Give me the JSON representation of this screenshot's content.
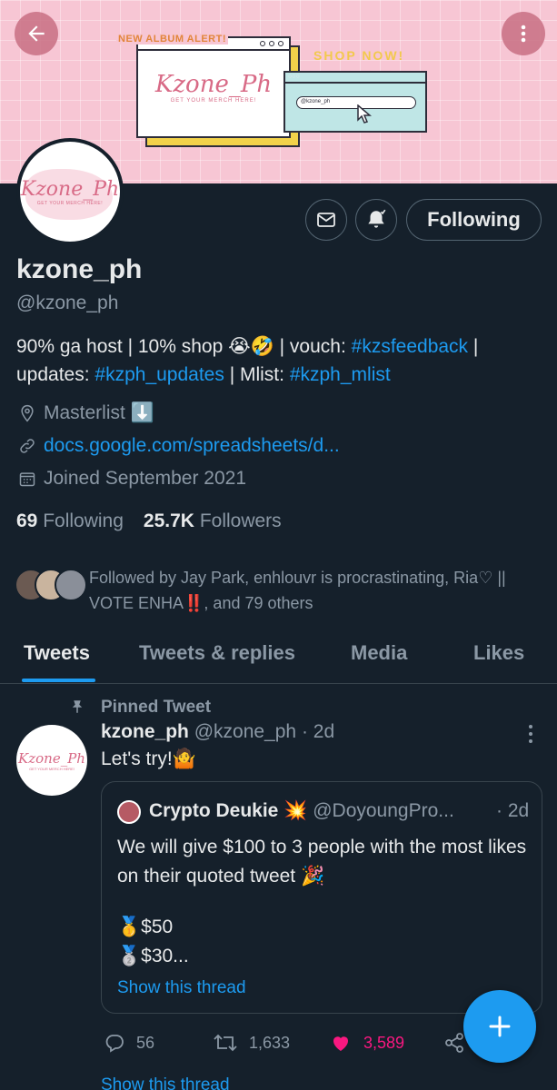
{
  "banner": {
    "alert_text": "NEW ALBUM ALERT!",
    "shop_text": "SHOP NOW!",
    "brand_script": "Kzone_Ph",
    "brand_tagline": "GET YOUR MERCH HERE!",
    "search_value": "@kzone_ph"
  },
  "avatar": {
    "brand_script": "Kzone_Ph",
    "tagline": "GET YOUR MERCH HERE!"
  },
  "profile": {
    "display_name": "kzone_ph",
    "handle": "@kzone_ph",
    "bio_1": "90% ga host | 10% shop 😭🤣 | vouch: ",
    "bio_hashtag_1": "#kzsfeedback",
    "bio_2": " |",
    "bio_3": "updates: ",
    "bio_hashtag_2": "#kzph_updates",
    "bio_4": " |  Mlist: ",
    "bio_hashtag_3": "#kzph_mlist",
    "location": "Masterlist ⬇️",
    "website": "docs.google.com/spreadsheets/d...",
    "joined": "Joined September 2021",
    "following_count": "69",
    "following_label": "Following",
    "followers_count": "25.7K",
    "followers_label": "Followers",
    "followed_by": "Followed by Jay Park, enhlouvr is procrastinating, Ria♡ || VOTE ENHA‼️, and 79 others",
    "follow_button": "Following"
  },
  "tabs": [
    "Tweets",
    "Tweets & replies",
    "Media",
    "Likes"
  ],
  "tweet": {
    "pinned_label": "Pinned Tweet",
    "author_name": "kzone_ph",
    "author_handle": "@kzone_ph",
    "time": "· 2d",
    "text": "Let's try!🤷",
    "quote": {
      "author_name": "Crypto Deukie",
      "author_badge": "💥",
      "author_handle": "@DoyoungPro...",
      "time": "· 2d",
      "text_1": "We will give $100 to 3 people with the most likes on their quoted tweet 🎉",
      "line_1": "🥇$50",
      "line_2": "🥈$30...",
      "show_thread": "Show this thread"
    },
    "replies": "56",
    "retweets": "1,633",
    "likes": "3,589",
    "show_thread": "Show this thread"
  },
  "colors": {
    "background": "#15202b",
    "accent": "#1d9bf0",
    "like": "#f91880",
    "muted": "#8b98a5"
  }
}
